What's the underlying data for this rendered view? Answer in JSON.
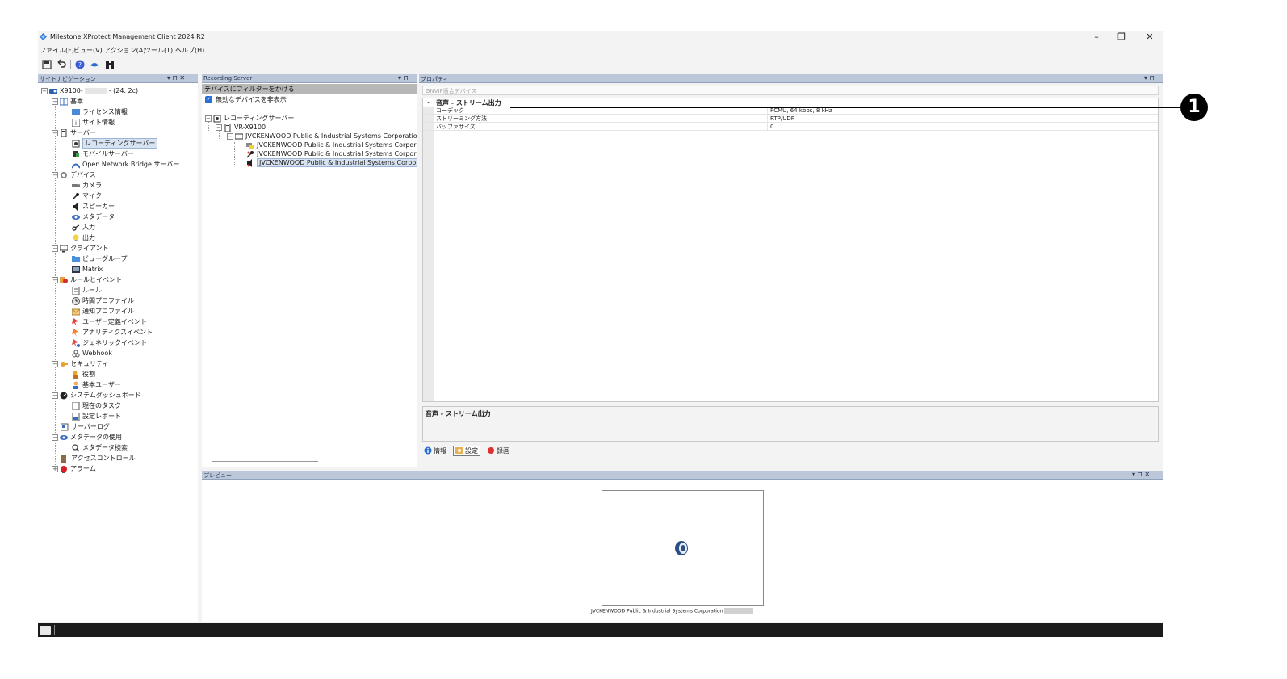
{
  "window": {
    "title": "Milestone XProtect Management Client 2024 R2",
    "minimize": "–",
    "restore": "❐",
    "close": "✕"
  },
  "menu": [
    "ファイル(F)",
    "ビュー(V)",
    "アクション(A)",
    "ツール(T)",
    "ヘルプ(H)"
  ],
  "site_nav": {
    "title": "サイトナビゲーション",
    "controls": "▾ ⊓ ✕",
    "root": "X9100-",
    "root_suffix": "- (24.  2c)",
    "items": {
      "basic": "基本",
      "license": "ライセンス情報",
      "site_info": "サイト情報",
      "servers": "サーバー",
      "recording_server": "レコーディングサーバー",
      "mobile_server": "モバイルサーバー",
      "onb_server": "Open Network Bridge サーバー",
      "devices": "デバイス",
      "camera": "カメラ",
      "mic": "マイク",
      "speaker": "スピーカー",
      "metadata": "メタデータ",
      "input": "入力",
      "output": "出力",
      "client": "クライアント",
      "view_group": "ビューグループ",
      "matrix": "Matrix",
      "rules_events": "ルールとイベント",
      "rules": "ルール",
      "time_profiles": "時間プロファイル",
      "notify_profiles": "通知プロファイル",
      "user_events": "ユーザー定義イベント",
      "analytics_events": "アナリティクスイベント",
      "generic_events": "ジェネリックイベント",
      "webhook": "Webhook",
      "security": "セキュリティ",
      "roles": "役割",
      "basic_users": "基本ユーザー",
      "dashboard": "システムダッシュボード",
      "current_tasks": "現在のタスク",
      "config_report": "設定レポート",
      "server_log": "サーバーログ",
      "metadata_use": "メタデータの使用",
      "metadata_search": "メタデータ検索",
      "access_control": "アクセスコントロール",
      "alarm": "アラーム"
    }
  },
  "recording_pane": {
    "title": "Recording Server",
    "controls": "▾ ⊓",
    "filter": "デバイスにフィルターをかける",
    "hide_disabled": "無効なデバイスを非表示",
    "tree": {
      "root": "レコーディングサーバー",
      "server": "VR-X9100",
      "device_group": "JVCKENWOOD Public & Industrial Systems Corporatio",
      "dev1": "JVCKENWOOD Public & Industrial Systems Corpor",
      "dev2": "JVCKENWOOD Public & Industrial Systems Corpor",
      "dev3": "JVCKENWOOD Public & Industrial Systems Corpor"
    }
  },
  "properties": {
    "title": "プロパティ",
    "controls": "▾ ⊓",
    "combo": "ONVIF適合デバイス",
    "category": "音声 - ストリーム出力",
    "rows": [
      {
        "name": "コーデック",
        "value": "PCMU, 64 kbps, 8 kHz"
      },
      {
        "name": "ストリーミング方法",
        "value": "RTP/UDP"
      },
      {
        "name": "バッファサイズ",
        "value": "0"
      }
    ],
    "description_title": "音声 - ストリーム出力",
    "tabs": {
      "info": "情報",
      "settings": "設定",
      "record": "録画"
    }
  },
  "preview": {
    "title": "プレビュー",
    "controls": "▾ ⊓ ✕",
    "caption": "JVCKENWOOD Public & Industrial Systems Corporation"
  },
  "callout": {
    "number": "1"
  },
  "colors": {
    "pane_header": "#bcc8d9",
    "selection": "#d8e3f2",
    "accent_blue": "#2a6ed6",
    "record_red": "#e03030"
  }
}
